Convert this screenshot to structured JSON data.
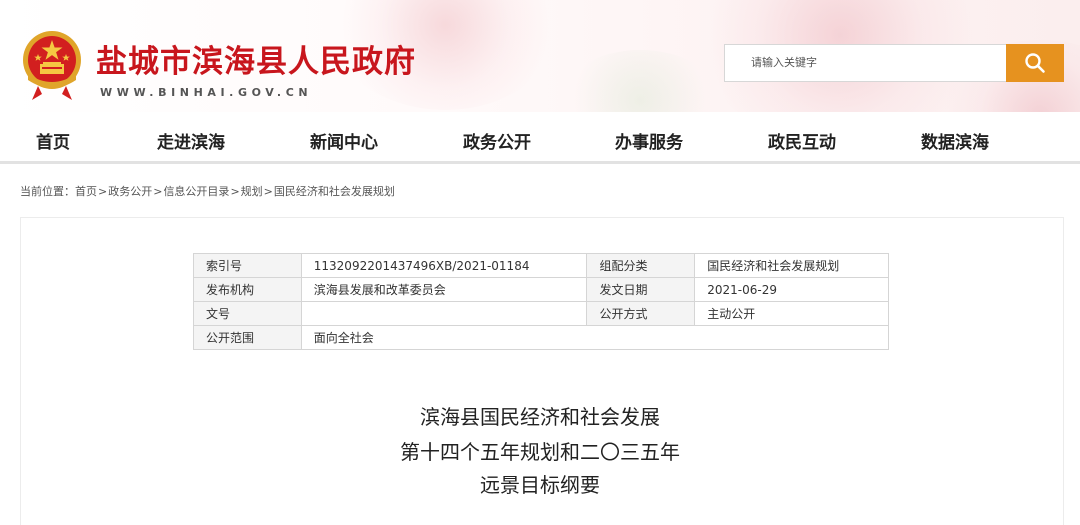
{
  "header": {
    "site_title": "盐城市滨海县人民政府",
    "site_url": "WWW.BINHAI.GOV.CN",
    "search_placeholder": "请输入关键字",
    "brand_color": "#c8161d",
    "search_button_color": "#e6921f",
    "search_icon": "search-icon",
    "emblem_icon": "national-emblem-icon"
  },
  "nav": {
    "items": [
      "首页",
      "走进滨海",
      "新闻中心",
      "政务公开",
      "办事服务",
      "政民互动",
      "数据滨海"
    ]
  },
  "breadcrumb": {
    "prefix": "当前位置：",
    "items": [
      "首页",
      "政务公开",
      "信息公开目录",
      "规划",
      "国民经济和社会发展规划"
    ],
    "separator": ">"
  },
  "meta_table": {
    "rows": [
      {
        "label1": "索引号",
        "value1": "1132092201437496XB/2021-01184",
        "label2": "组配分类",
        "value2": "国民经济和社会发展规划"
      },
      {
        "label1": "发布机构",
        "value1": "滨海县发展和改革委员会",
        "label2": "发文日期",
        "value2": "2021-06-29"
      },
      {
        "label1": "文号",
        "value1": "",
        "label2": "公开方式",
        "value2": "主动公开"
      },
      {
        "label1": "公开范围",
        "value1": "面向全社会"
      }
    ]
  },
  "document": {
    "title_lines": [
      "滨海县国民经济和社会发展",
      "第十四个五年规划和二〇三五年",
      "远景目标纲要"
    ]
  }
}
